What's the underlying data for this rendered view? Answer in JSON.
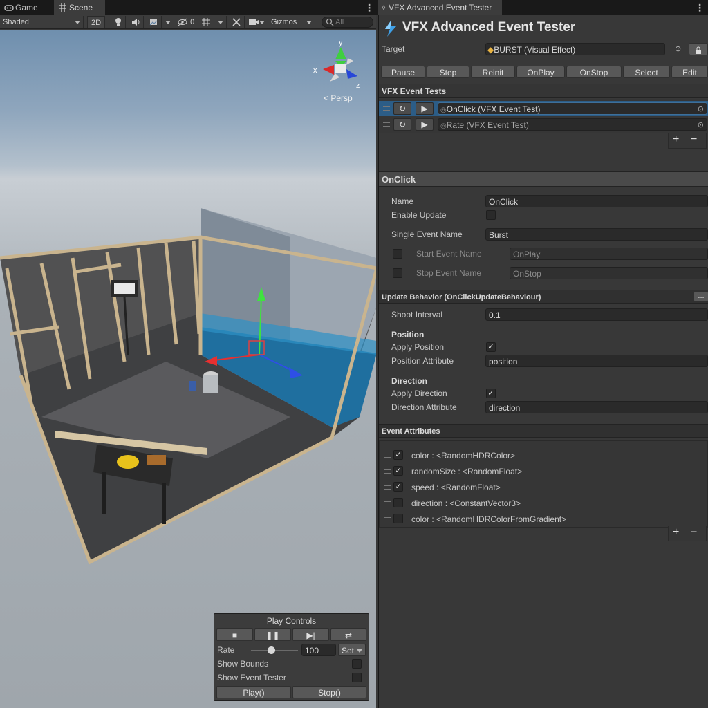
{
  "tabs": {
    "game": "Game",
    "scene": "Scene",
    "inspector": "VFX Advanced Event Tester"
  },
  "scene_toolbar": {
    "shading_mode": "Shaded",
    "mode_2d": "2D",
    "hidden_count": "0",
    "gizmos": "Gizmos",
    "search_placeholder": "All"
  },
  "gizmo": {
    "x": "x",
    "y": "y",
    "z": "z",
    "persp": "Persp"
  },
  "play_controls": {
    "title": "Play Controls",
    "rate_label": "Rate",
    "rate_value": "100",
    "rate_fraction": 0.42,
    "set_label": "Set",
    "show_bounds_label": "Show Bounds",
    "show_bounds": false,
    "show_event_tester_label": "Show Event Tester",
    "show_event_tester": false,
    "play_button": "Play()",
    "stop_button": "Stop()"
  },
  "inspector": {
    "title": "VFX Advanced Event Tester",
    "target_label": "Target",
    "target_value": "BURST (Visual Effect)",
    "action_buttons": [
      "Pause",
      "Step",
      "Reinit",
      "OnPlay",
      "OnStop",
      "Select",
      "Edit"
    ],
    "event_tests_header": "VFX Event Tests",
    "event_tests": [
      {
        "label": "OnClick (VFX Event Test)",
        "selected": true
      },
      {
        "label": "Rate (VFX Event Test)",
        "selected": false
      }
    ],
    "section_title": "OnClick",
    "fields": {
      "name_label": "Name",
      "name_value": "OnClick",
      "enable_update_label": "Enable Update",
      "enable_update": false,
      "single_event_label": "Single Event Name",
      "single_event_value": "Burst",
      "start_event_label": "Start Event Name",
      "start_event_value": "OnPlay",
      "start_event_enabled": false,
      "stop_event_label": "Stop Event Name",
      "stop_event_value": "OnStop",
      "stop_event_enabled": false
    },
    "update_behavior_header": "Update Behavior (OnClickUpdateBehaviour)",
    "update_behavior_menu": "...",
    "update": {
      "shoot_interval_label": "Shoot Interval",
      "shoot_interval_value": "0.1",
      "position_header": "Position",
      "apply_position_label": "Apply Position",
      "apply_position": true,
      "position_attribute_label": "Position Attribute",
      "position_attribute_value": "position",
      "direction_header": "Direction",
      "apply_direction_label": "Apply Direction",
      "apply_direction": true,
      "direction_attribute_label": "Direction Attribute",
      "direction_attribute_value": "direction"
    },
    "event_attributes_header": "Event Attributes",
    "event_attributes": [
      {
        "label": "color : <RandomHDRColor>",
        "checked": true
      },
      {
        "label": "randomSize : <RandomFloat>",
        "checked": true
      },
      {
        "label": "speed : <RandomFloat>",
        "checked": true
      },
      {
        "label": "direction : <ConstantVector3>",
        "checked": false
      },
      {
        "label": "color : <RandomHDRColorFromGradient>",
        "checked": false
      }
    ]
  },
  "icon_names": [
    "gamepad-icon",
    "scene-grid-icon",
    "lightbulb-icon",
    "audio-icon",
    "effects-icon",
    "hidden-eye-icon",
    "grid-icon",
    "tools-icon",
    "camera-icon",
    "search-icon",
    "vfx-asset-icon",
    "object-picker-icon",
    "lock-icon",
    "refresh-icon",
    "play-icon",
    "stop-icon",
    "pause-icon",
    "step-icon",
    "loop-icon"
  ]
}
